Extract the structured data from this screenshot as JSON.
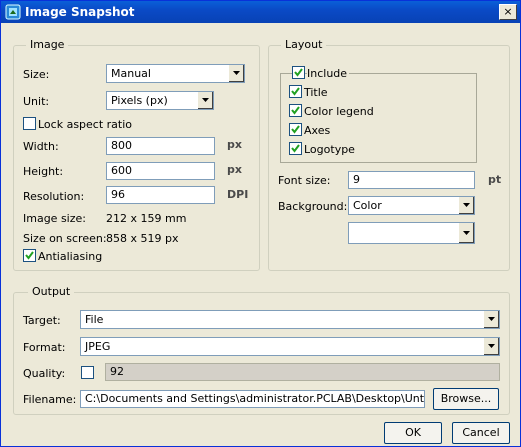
{
  "window": {
    "title": "Image Snapshot",
    "close_label": "×"
  },
  "image": {
    "legend": "Image",
    "size_label": "Size:",
    "size_value": "Manual",
    "unit_label": "Unit:",
    "unit_value": "Pixels (px)",
    "lock_label": "Lock aspect ratio",
    "lock_checked": false,
    "width_label": "Width:",
    "width_value": "800",
    "width_unit": "px",
    "height_label": "Height:",
    "height_value": "600",
    "height_unit": "px",
    "resolution_label": "Resolution:",
    "resolution_value": "96",
    "resolution_unit": "DPI",
    "image_size_label": "Image size:",
    "image_size_value": "212 x 159 mm",
    "size_on_screen_label": "Size on screen:",
    "size_on_screen_value": "858 x 519 px",
    "antialiasing_label": "Antialiasing",
    "antialiasing_checked": true
  },
  "layout": {
    "legend": "Layout",
    "include_label": "Include",
    "include_checked": true,
    "title_label": "Title",
    "title_checked": true,
    "color_legend_label": "Color legend",
    "color_legend_checked": true,
    "axes_label": "Axes",
    "axes_checked": true,
    "logotype_label": "Logotype",
    "logotype_checked": true,
    "font_size_label": "Font size:",
    "font_size_value": "9",
    "font_size_unit": "pt",
    "background_label": "Background:",
    "background_value": "Color",
    "background_color_value": ""
  },
  "output": {
    "legend": "Output",
    "target_label": "Target:",
    "target_value": "File",
    "format_label": "Format:",
    "format_value": "JPEG",
    "quality_label": "Quality:",
    "quality_checked": false,
    "quality_value": "92",
    "filename_label": "Filename:",
    "filename_value": "C:\\Documents and Settings\\administrator.PCLAB\\Desktop\\Untitled.jpg",
    "browse_label": "Browse..."
  },
  "buttons": {
    "ok_label": "OK",
    "cancel_label": "Cancel"
  }
}
